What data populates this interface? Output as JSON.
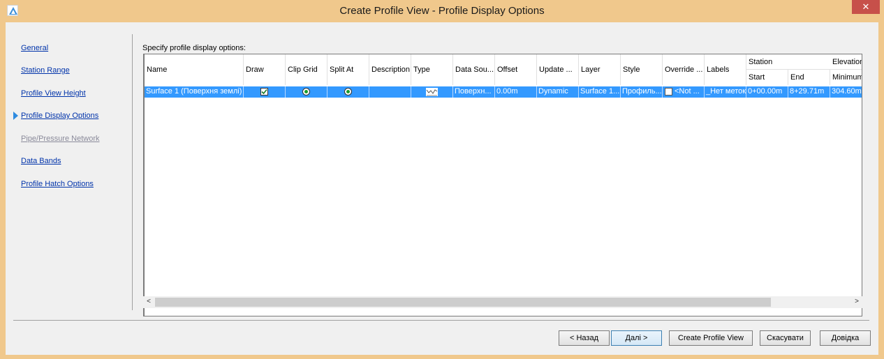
{
  "window": {
    "title": "Create Profile View - Profile Display Options",
    "close_glyph": "✕"
  },
  "nav": {
    "items": [
      {
        "label": "General",
        "state": "enabled"
      },
      {
        "label": "Station Range",
        "state": "enabled"
      },
      {
        "label": "Profile View Height",
        "state": "enabled"
      },
      {
        "label": "Profile Display Options",
        "state": "current"
      },
      {
        "label": "Pipe/Pressure Network",
        "state": "disabled"
      },
      {
        "label": "Data Bands",
        "state": "enabled"
      },
      {
        "label": "Profile Hatch Options",
        "state": "enabled"
      }
    ]
  },
  "instruction": "Specify profile display options:",
  "grid": {
    "columns": {
      "name": "Name",
      "draw": "Draw",
      "clip_grid": "Clip Grid",
      "split_at": "Split At",
      "description": "Description",
      "type": "Type",
      "data_source": "Data Sou...",
      "offset": "Offset",
      "update_mode": "Update ...",
      "layer": "Layer",
      "style": "Style",
      "override": "Override ...",
      "labels": "Labels",
      "station": "Station",
      "station_start": "Start",
      "station_end": "End",
      "elevation": "Elevation",
      "elevation_min": "Minimum"
    },
    "rows": [
      {
        "name": "Surface 1 (Поверхня землі)",
        "draw": true,
        "clip_grid": true,
        "split_at": true,
        "description": "",
        "type_icon": "surface-profile-icon",
        "data_source": "Поверхн...",
        "offset": "0.00m",
        "update_mode": "Dynamic",
        "layer": "Surface 1...",
        "style": "Профиль...",
        "override": "<Not ...",
        "labels": "_Нет меток",
        "station_start": "0+00.00m",
        "station_end": "8+29.71m",
        "elevation_min": "304.60m"
      }
    ]
  },
  "scrollbar": {
    "left_glyph": "<",
    "right_glyph": ">"
  },
  "buttons": {
    "back": "< Назад",
    "next": "Далі >",
    "create": "Create Profile View",
    "cancel": "Скасувати",
    "help": "Довідка"
  },
  "colors": {
    "title_bar": "#f0c88c",
    "selection": "#3399ff",
    "link": "#0033aa",
    "current_arrow": "#2e8be0"
  }
}
